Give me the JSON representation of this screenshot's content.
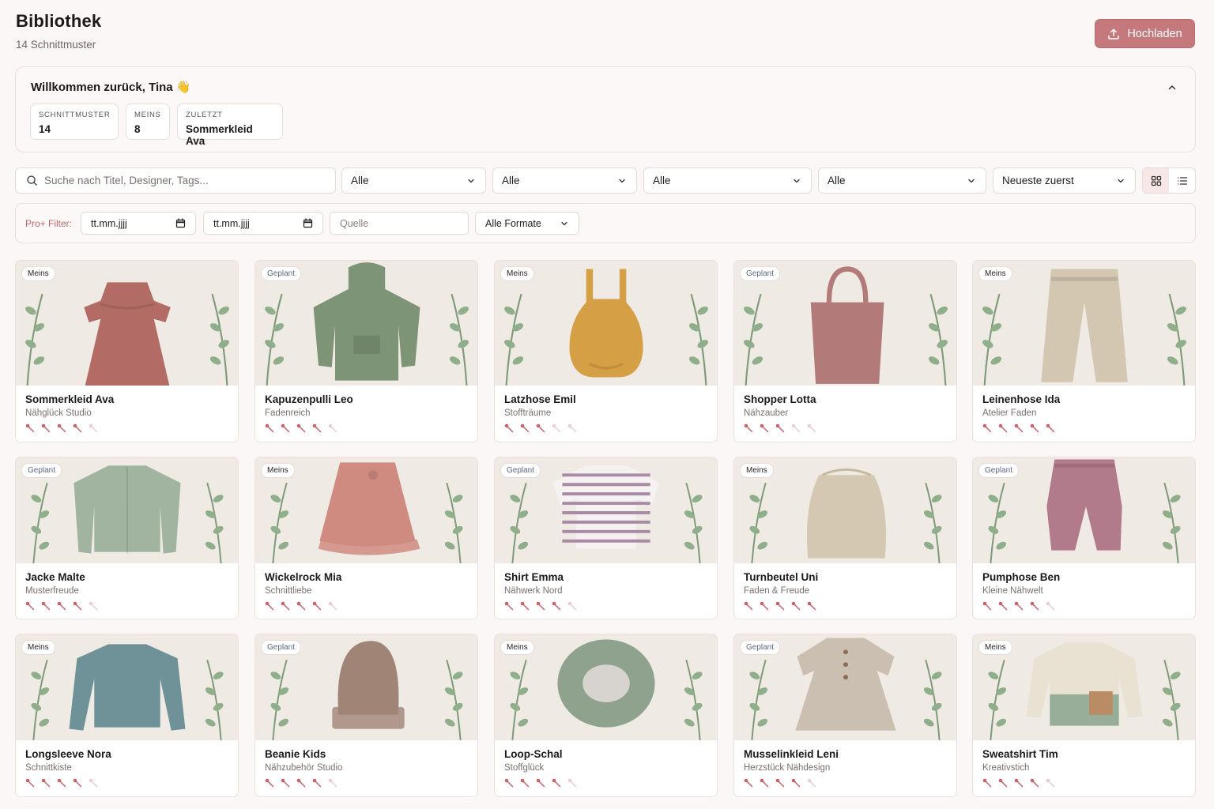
{
  "header": {
    "title": "Bibliothek",
    "subtitle": "14 Schnittmuster",
    "upload_label": "Hochladen"
  },
  "welcome": {
    "title": "Willkommen zurück, Tina 👋",
    "stats": [
      {
        "label": "Schnittmuster",
        "value": "14"
      },
      {
        "label": "Meins",
        "value": "8"
      },
      {
        "label": "Zuletzt",
        "value": "Sommerkleid Ava"
      }
    ]
  },
  "filters": {
    "search_placeholder": "Suche nach Titel, Designer, Tags...",
    "selects": [
      "Alle",
      "Alle",
      "Alle",
      "Alle"
    ],
    "sort": "Neueste zuerst",
    "view_mode": "grid"
  },
  "pro_filter": {
    "label": "Pro+ Filter:",
    "date_from": "tt.mm.jjjj",
    "date_to": "tt.mm.jjjj",
    "source_placeholder": "Quelle",
    "format": "Alle Formate"
  },
  "colors": {
    "accent": "#c5797c",
    "pin_filled": "#c9636a",
    "pin_empty": "#e8cfd0"
  },
  "patterns": [
    {
      "title": "Sommerkleid Ava",
      "designer": "Nähglück Studio",
      "badge": "Meins",
      "rating": 4,
      "item": "dress",
      "color": "#b36b66"
    },
    {
      "title": "Kapuzenpulli Leo",
      "designer": "Fadenreich",
      "badge": "Geplant",
      "rating": 4,
      "item": "hoodie",
      "color": "#7d9477"
    },
    {
      "title": "Latzhose Emil",
      "designer": "Stoffträume",
      "badge": "Meins",
      "rating": 3,
      "item": "romper",
      "color": "#d49f45"
    },
    {
      "title": "Shopper Lotta",
      "designer": "Nähzauber",
      "badge": "Geplant",
      "rating": 3,
      "item": "bag",
      "color": "#b27a78"
    },
    {
      "title": "Leinenhose Ida",
      "designer": "Atelier Faden",
      "badge": "Meins",
      "rating": 5,
      "item": "pants",
      "color": "#d3c7b1"
    },
    {
      "title": "Jacke Malte",
      "designer": "Musterfreude",
      "badge": "Geplant",
      "rating": 4,
      "item": "jacket",
      "color": "#a1b4a0"
    },
    {
      "title": "Wickelrock Mia",
      "designer": "Schnittliebe",
      "badge": "Meins",
      "rating": 4,
      "item": "skirt",
      "color": "#d08b81"
    },
    {
      "title": "Shirt Emma",
      "designer": "Nähwerk Nord",
      "badge": "Geplant",
      "rating": 4,
      "item": "tshirt",
      "color": "#a98ba6"
    },
    {
      "title": "Turnbeutel Uni",
      "designer": "Faden & Freude",
      "badge": "Meins",
      "rating": 5,
      "item": "sack",
      "color": "#d4c8b2"
    },
    {
      "title": "Pumphose Ben",
      "designer": "Kleine Nähwelt",
      "badge": "Geplant",
      "rating": 4,
      "item": "pumphose",
      "color": "#b27b8b"
    },
    {
      "title": "Longsleeve Nora",
      "designer": "Schnittkiste",
      "badge": "Meins",
      "rating": 4,
      "item": "longsleeve",
      "color": "#6e9297"
    },
    {
      "title": "Beanie Kids",
      "designer": "Nähzubehör Studio",
      "badge": "Geplant",
      "rating": 4,
      "item": "beanie",
      "color": "#a08476"
    },
    {
      "title": "Loop-Schal",
      "designer": "Stoffglück",
      "badge": "Meins",
      "rating": 4,
      "item": "scarf",
      "color": "#8fa28e"
    },
    {
      "title": "Musselinkleid Leni",
      "designer": "Herzstück Nähdesign",
      "badge": "Geplant",
      "rating": 4,
      "item": "muslindress",
      "color": "#cbbfb1"
    },
    {
      "title": "Sweatshirt Tim",
      "designer": "Kreativstich",
      "badge": "Meins",
      "rating": 4,
      "item": "sweatshirt",
      "color": "#e9e1d1"
    }
  ]
}
